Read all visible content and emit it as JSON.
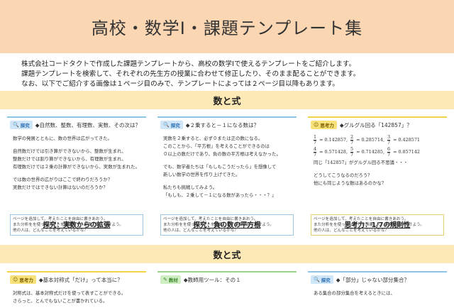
{
  "header": {
    "title": "高校・数学Ⅰ・課題テンプレート集"
  },
  "intro": {
    "lines": [
      "株式会社コードタクトで作成した課題テンプレートから、高校の数学Ⅰで使えるテンプレートをご紹介します。",
      "課題テンプレートを検索して、それぞれの先生方の授業に合わせて修正したり、そのまま配ることができます。",
      "なお、以下でご紹介する画像は１ページ目のみで、テンプレートによっては２ページ目以降もあります。"
    ]
  },
  "sections": [
    {
      "title": "数と式"
    },
    {
      "title": "数と式"
    }
  ],
  "cards": [
    {
      "tag": "探究",
      "head_title": "◆自然数、整数、有理数、実数、その次は？",
      "body": [
        "数学の発展とともに、数の世界は広がってきた。",
        "",
        "自然数だけでは引き算ができないから、整数が生まれ、",
        "整数だけでは割り算ができないから、有理数が生まれ、",
        "有理数だけでは２乗の計算ができないから、実数が生まれた。",
        "",
        "では数の世界の広がりはここで終わりだろうか？",
        "実数だけではできない計算はないのだろうか？"
      ],
      "note": [
        "ページを追加して、考えたことを自由に書きあおう。",
        "また分析をを使ったノートを清書して、画像で貼り付けよう。",
        "他の人は、どんなことを考えているかな？"
      ],
      "caption": "探究：実数からの拡張"
    },
    {
      "tag": "探究",
      "head_title": "◆２乗すると－１になる数は？",
      "body": [
        "実数を２乗すると、必ず０または正の数になる。",
        "このことから、「平方根」を考えることができるのは",
        "０以上の数だけであり、負の数の平方根は考えなかった。",
        "",
        "でも、数学者たちは「もしもこうだったら」を想像して",
        "新しい数学の世界を作り上げてきた。",
        "",
        "私たちも挑戦してみよう。",
        "「もしも、２乗して－１になる数があったら・・・？」"
      ],
      "note": [
        "ページを追加して、考えたことを自由に書きあおう。",
        "また分析をを使ったノートを清書して、画像で貼り付けよう。",
        "他の人は、どんなことを考えているかな？"
      ],
      "caption": "探究：負の数の平方根"
    },
    {
      "tag": "思考力",
      "head_title": "◆グルグル回る「142857」？",
      "fractions": [
        {
          "num": "1",
          "den": "7",
          "val": "= 0.142857,"
        },
        {
          "num": "2",
          "den": "7",
          "val": "= 0.285714,"
        },
        {
          "num": "3",
          "den": "7",
          "val": "= 0.428571"
        },
        {
          "num": "4",
          "den": "7",
          "val": "= 0.571428,"
        },
        {
          "num": "5",
          "den": "7",
          "val": "= 0.714285,"
        },
        {
          "num": "6",
          "den": "7",
          "val": "= 0.857142"
        }
      ],
      "body": [
        "同じ「142857」がグルグル回る不思議・・・",
        "",
        "どうしてこうなるのだろう？",
        "他にも同じような数はあるのかな？"
      ],
      "note": [
        "ページを追加して、考えたことを自由に書きあおう。",
        "また分析をを使ったノートを清書して、画像で貼り付けよう。",
        "他の人は、どんなことを考えているかな？"
      ],
      "caption": "思考力：1/7の規則性"
    }
  ],
  "bottom_cards": [
    {
      "tag": "思考力",
      "head_title": "◆基本対称式「だけ」って本当に？",
      "body": [
        "対称式は、基本対称式だけを使って表すことができる。",
        "さらっと、とんでもないことが書かれている。"
      ]
    },
    {
      "tag": "教材",
      "head_title": "◆教師用ツール：その１",
      "body": []
    },
    {
      "tag": "探究",
      "head_title": "◆「部分」じゃない部分集合？",
      "body": [
        "",
        "ある集合の部分集合を考えるときには、"
      ]
    }
  ]
}
